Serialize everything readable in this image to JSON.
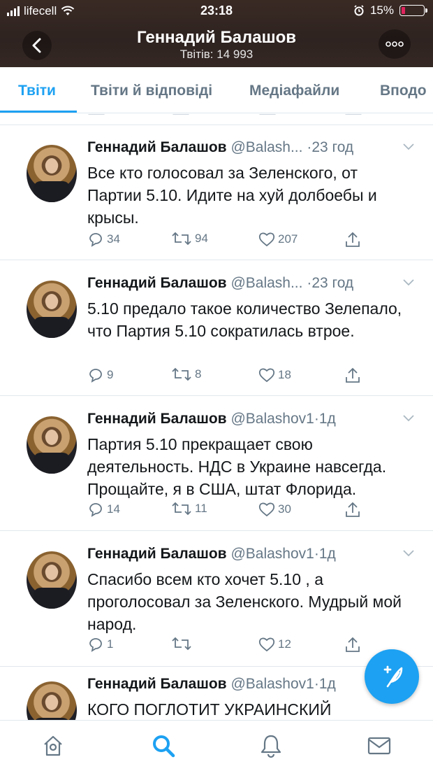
{
  "status_bar": {
    "carrier": "lifecell",
    "time": "23:18",
    "battery_percent": "15%",
    "battery_level": 0.15
  },
  "header": {
    "title": "Геннадий Балашов",
    "subtitle": "Твітів: 14 993",
    "back_icon": "chevron-left-icon",
    "more_icon": "more-dots-icon"
  },
  "tabs": [
    {
      "label": "Твіти",
      "active": true
    },
    {
      "label": "Твіти й відповіді",
      "active": false
    },
    {
      "label": "Медіафайли",
      "active": false
    },
    {
      "label": "Вподо",
      "active": false
    }
  ],
  "tweets": [
    {
      "name": "Геннадий Балашов",
      "handle": "@Balash...",
      "dot": "·",
      "time": "23 год",
      "text": "Все кто голосовал за Зеленского, от Партии 5.10. Идите на хуй долбоебы и крысы.",
      "replies": "34",
      "retweets": "94",
      "likes": "207"
    },
    {
      "name": "Геннадий Балашов",
      "handle": "@Balash...",
      "dot": "·",
      "time": "23 год",
      "text": "5.10 предало такое количество Зелепало, что  Партия 5.10 сократилась втрое.",
      "replies": "9",
      "retweets": "8",
      "likes": "18"
    },
    {
      "name": "Геннадий Балашов",
      "handle": "@Balashov1",
      "dot": "·",
      "time": "1д",
      "text": "Партия 5.10 прекращает свою деятельность.  НДС в Украине навсегда. Прощайте, я в США, штат Флорида.",
      "replies": "14",
      "retweets": "11",
      "likes": "30"
    },
    {
      "name": "Геннадий Балашов",
      "handle": "@Balashov1",
      "dot": "·",
      "time": "1д",
      "text": "Спасибо всем кто хочет 5.10 , а проголосовал за Зеленского. Мудрый мой народ.",
      "replies": "1",
      "retweets": "",
      "likes": "12"
    },
    {
      "name": "Геннадий Балашов",
      "handle": "@Balashov1",
      "dot": "·",
      "time": "1д",
      "text": "КОГО ПОГЛОТИТ УКРАИНСКИЙ",
      "replies": "",
      "retweets": "",
      "likes": ""
    }
  ],
  "fab": {
    "icon": "compose-tweet-icon"
  },
  "bottom_nav": [
    {
      "icon": "home-icon",
      "active": false
    },
    {
      "icon": "search-icon",
      "active": true
    },
    {
      "icon": "bell-icon",
      "active": false
    },
    {
      "icon": "mail-icon",
      "active": false
    }
  ],
  "colors": {
    "accent": "#1da1f2",
    "secondary_text": "#657786",
    "primary_text": "#14171a",
    "header_bg": "#2e2320"
  }
}
